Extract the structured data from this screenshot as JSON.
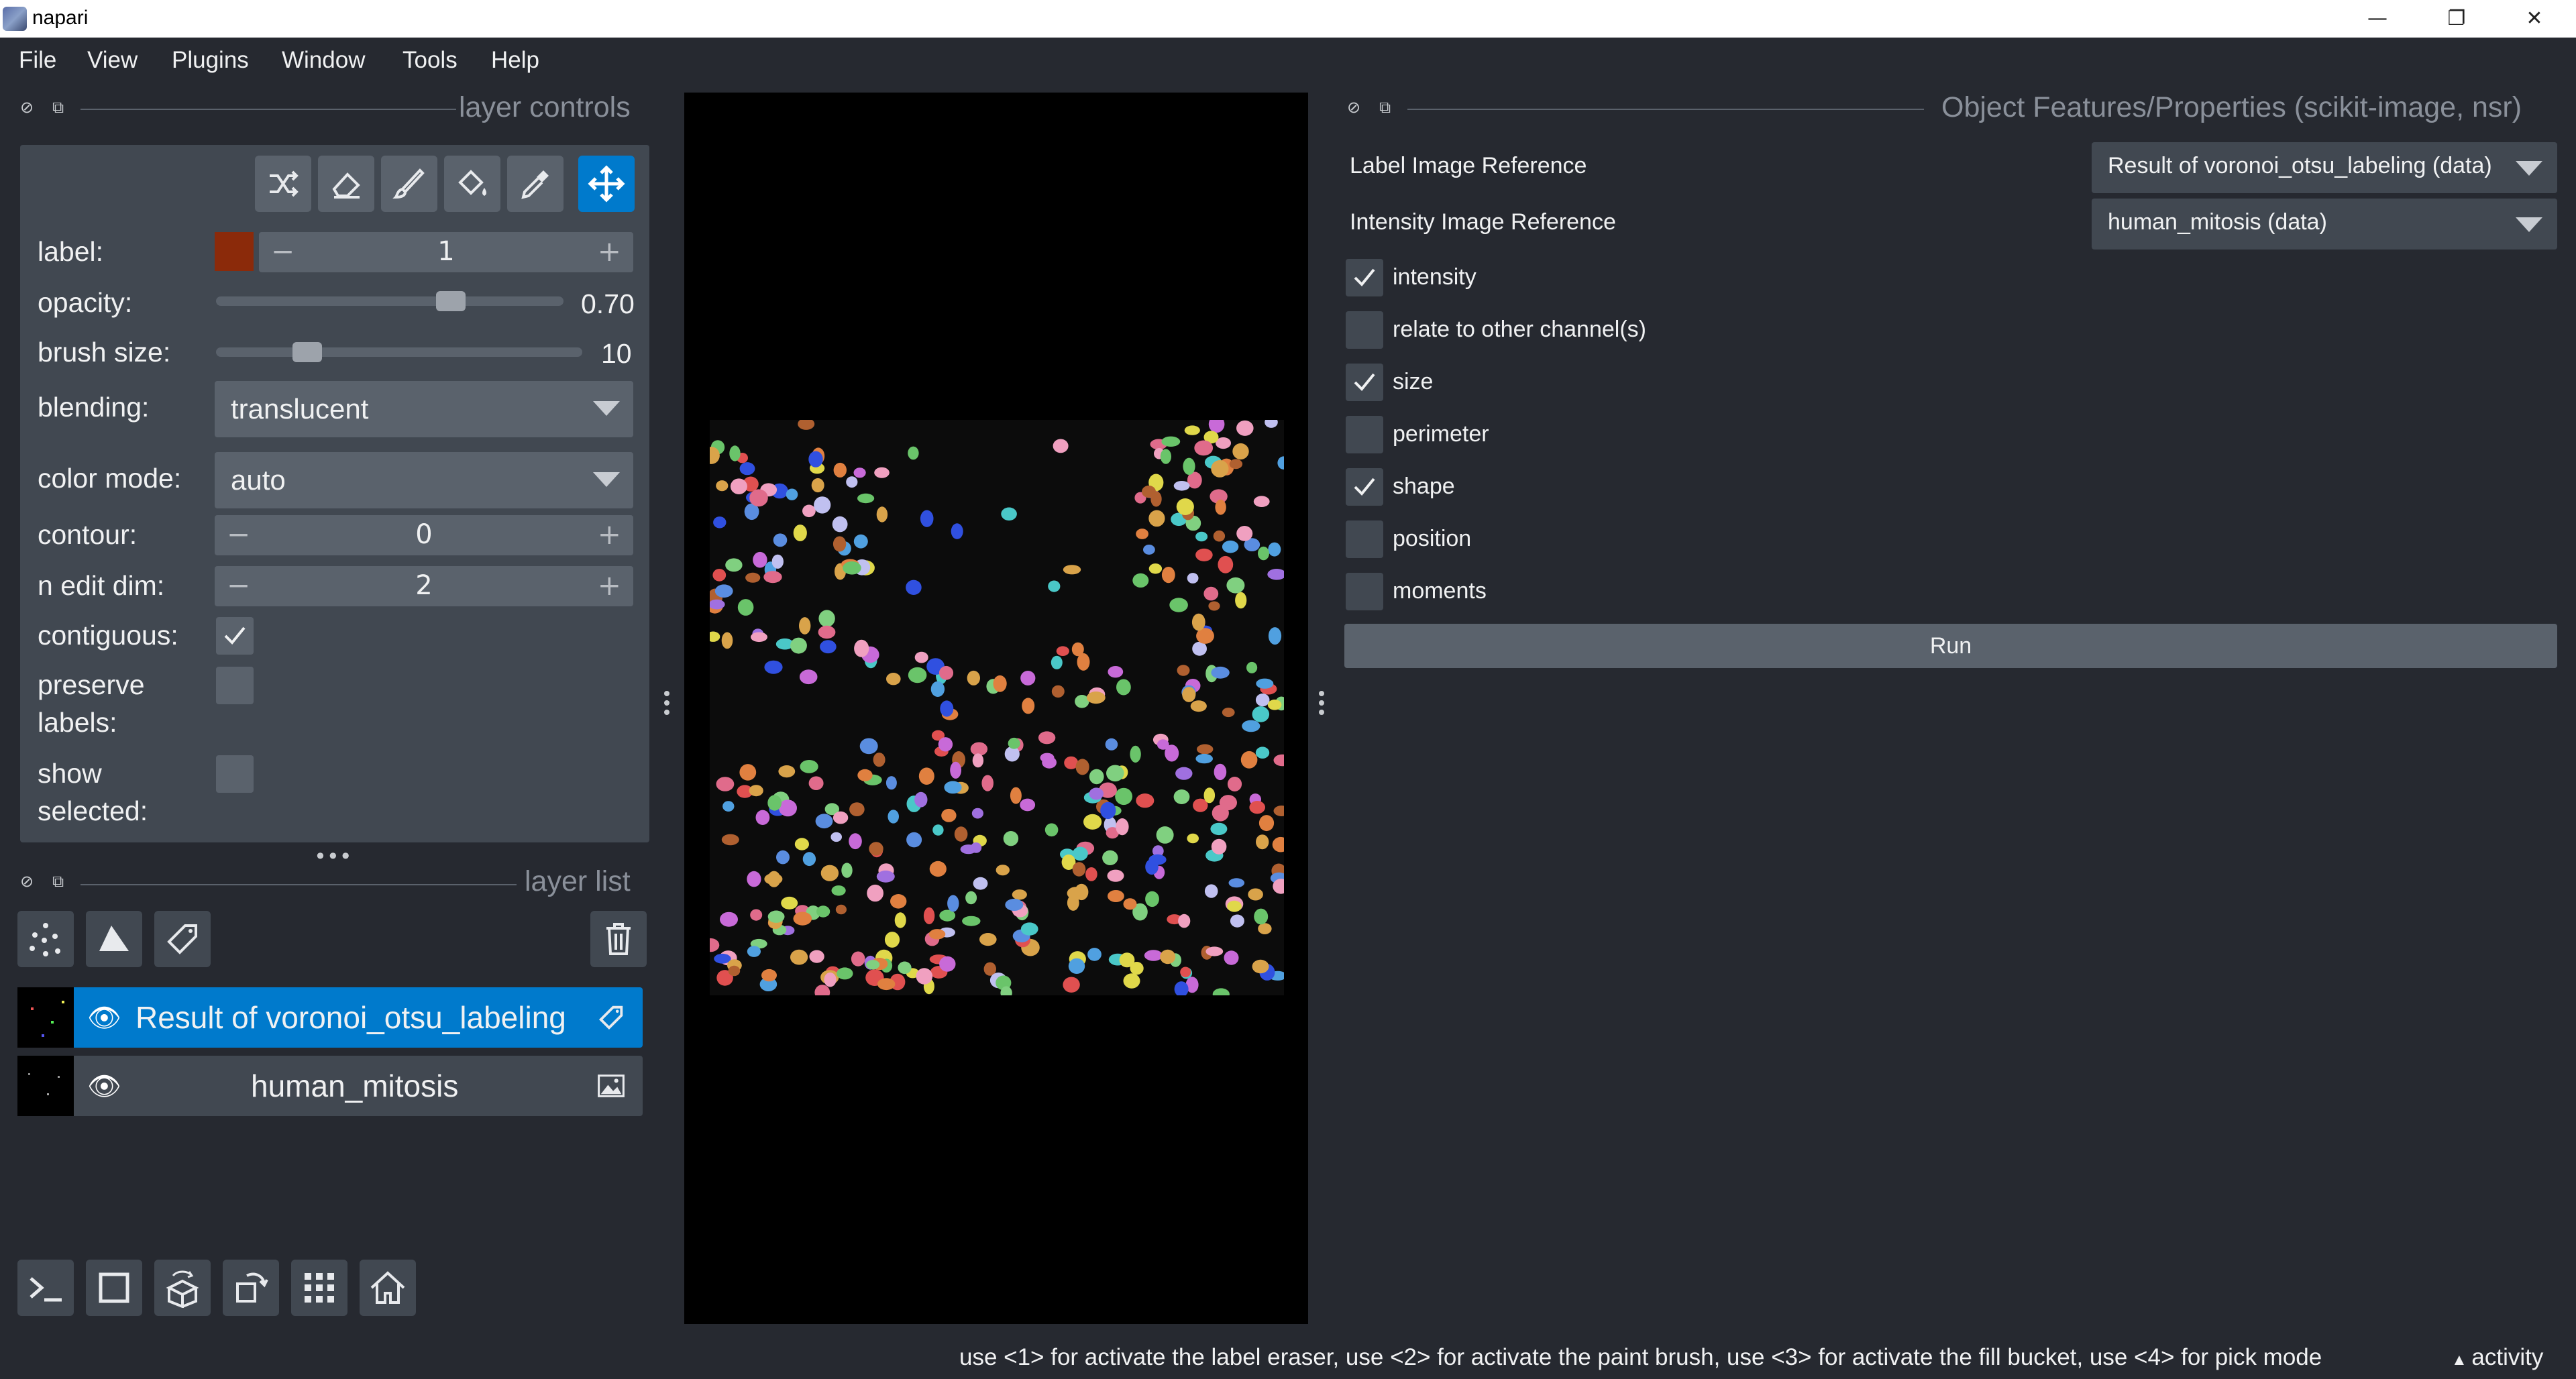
{
  "window": {
    "title": "napari",
    "controls": {
      "minimize": "—",
      "restore": "❐",
      "close": "✕"
    }
  },
  "menu": [
    "File",
    "View",
    "Plugins",
    "Window",
    "Tools",
    "Help"
  ],
  "layer_controls": {
    "title": "layer controls",
    "tools": [
      "shuffle-icon",
      "eraser-icon",
      "paint-brush-icon",
      "fill-bucket-icon",
      "color-picker-icon",
      "pan-zoom-icon"
    ],
    "active_tool": "pan-zoom-icon",
    "label": {
      "text": "label:",
      "value": "1",
      "color": "#8b2a0a"
    },
    "opacity": {
      "text": "opacity:",
      "value": "0.70",
      "fraction": 0.7
    },
    "brush_size": {
      "text": "brush size:",
      "value": "10",
      "fraction": 0.25
    },
    "blending": {
      "text": "blending:",
      "value": "translucent"
    },
    "color_mode": {
      "text": "color mode:",
      "value": "auto"
    },
    "contour": {
      "text": "contour:",
      "value": "0"
    },
    "n_edit_dim": {
      "text": "n edit dim:",
      "value": "2"
    },
    "contiguous": {
      "text": "contiguous:",
      "checked": true
    },
    "preserve_labels": {
      "text1": "preserve",
      "text2": "labels:",
      "checked": false
    },
    "show_selected": {
      "text1": "show",
      "text2": "selected:",
      "checked": false
    }
  },
  "layer_list": {
    "title": "layer list",
    "layers": [
      {
        "name": "Result of voronoi_otsu_labeling",
        "selected": true,
        "type_icon": "label-tag-icon"
      },
      {
        "name": "human_mitosis",
        "selected": false,
        "type_icon": "image-icon"
      }
    ]
  },
  "right_panel": {
    "title": "Object Features/Properties (scikit-image, nsr)",
    "label_image": {
      "label": "Label Image Reference",
      "value": "Result of voronoi_otsu_labeling (data)"
    },
    "intensity_image": {
      "label": "Intensity Image Reference",
      "value": "human_mitosis (data)"
    },
    "checks": [
      {
        "label": "intensity",
        "checked": true
      },
      {
        "label": "relate to other channel(s)",
        "checked": false
      },
      {
        "label": "size",
        "checked": true
      },
      {
        "label": "perimeter",
        "checked": false
      },
      {
        "label": "shape",
        "checked": true
      },
      {
        "label": "position",
        "checked": false
      },
      {
        "label": "moments",
        "checked": false
      }
    ],
    "run": "Run"
  },
  "statusbar": {
    "message": "use <1> for activate the label eraser, use <2> for activate the paint brush, use <3> for activate the fill bucket, use <4> for pick mode",
    "activity": "activity"
  }
}
